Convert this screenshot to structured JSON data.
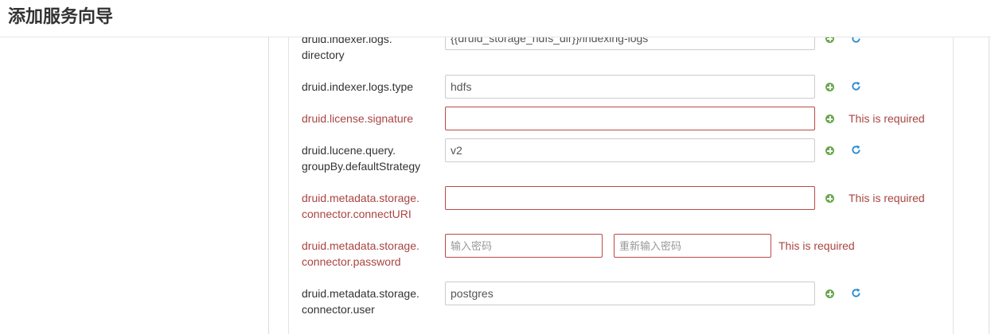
{
  "header": {
    "title": "添加服务向导"
  },
  "rows": [
    {
      "label_line1": "druid.indexer.logs.",
      "label_line2": "directory",
      "value": "{{druid_storage_hdfs_dir}}/indexing-logs",
      "error": ""
    },
    {
      "label_line1": "druid.indexer.logs.type",
      "label_line2": "",
      "value": "hdfs",
      "error": ""
    },
    {
      "label_line1": "druid.license.signature",
      "label_line2": "",
      "value": "",
      "error": "This is required"
    },
    {
      "label_line1": "druid.lucene.query.",
      "label_line2": "groupBy.defaultStrategy",
      "value": "v2",
      "error": ""
    },
    {
      "label_line1": "druid.metadata.storage.",
      "label_line2": "connector.connectURI",
      "value": "",
      "error": "This is required"
    },
    {
      "label_line1": "druid.metadata.storage.",
      "label_line2": "connector.password",
      "password_placeholder": "输入密码",
      "confirm_placeholder": "重新输入密码",
      "error": "This is required"
    },
    {
      "label_line1": "druid.metadata.storage.",
      "label_line2": "connector.user",
      "value": "postgres",
      "error": ""
    }
  ],
  "colors": {
    "error": "#a94442",
    "add_icon": "#6aa84f",
    "refresh_icon": "#2a8bd1"
  },
  "icons": {
    "add": "plus-circle-icon",
    "refresh": "refresh-icon"
  }
}
